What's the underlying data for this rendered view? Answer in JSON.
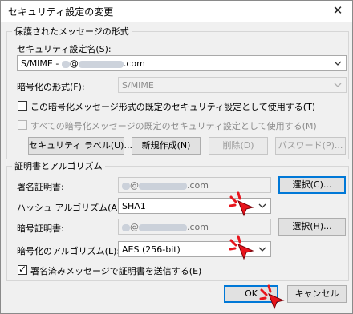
{
  "window": {
    "title": "セキュリティ設定の変更",
    "close_glyph": "✕"
  },
  "protected_group": {
    "legend": "保護されたメッセージの形式",
    "setting_name_label": "セキュリティ設定名(S):",
    "setting_name_prefix": "S/MIME - ",
    "setting_name_at": "@",
    "setting_name_domain": ".com",
    "crypto_format_label": "暗号化の形式(F):",
    "crypto_format_value": "S/MIME",
    "default_for_format_label": "この暗号化メッセージ形式の既定のセキュリティ設定として使用する(T)",
    "default_for_format_checked": false,
    "default_for_all_label": "すべての暗号化メッセージの既定のセキュリティ設定として使用する(M)",
    "default_for_all_checked": false,
    "security_labels_button": "セキュリティ ラベル(U)...",
    "new_button": "新規作成(N)",
    "delete_button": "削除(D)",
    "password_button": "パスワード(P)..."
  },
  "cert_group": {
    "legend": "証明書とアルゴリズム",
    "signing_cert_label": "署名証明書:",
    "signing_cert_at": "@",
    "signing_cert_domain": ".com",
    "select_button_1": "選択(C)...",
    "hash_algorithm_label": "ハッシュ アルゴリズム(A):",
    "hash_algorithm_value": "SHA1",
    "encryption_cert_label": "暗号証明書:",
    "encryption_cert_at": "@",
    "encryption_cert_domain": ".com",
    "select_button_2": "選択(H)...",
    "encryption_algorithm_label": "暗号化のアルゴリズム(L):",
    "encryption_algorithm_value": "AES (256-bit)",
    "send_certs_label": "署名済みメッセージで証明書を送信する(E)",
    "send_certs_checked": true
  },
  "footer": {
    "ok_button": "OK",
    "cancel_button": "キャンセル"
  },
  "colors": {
    "focus_border": "#0078d7",
    "cursor_red": "#e8141c"
  }
}
